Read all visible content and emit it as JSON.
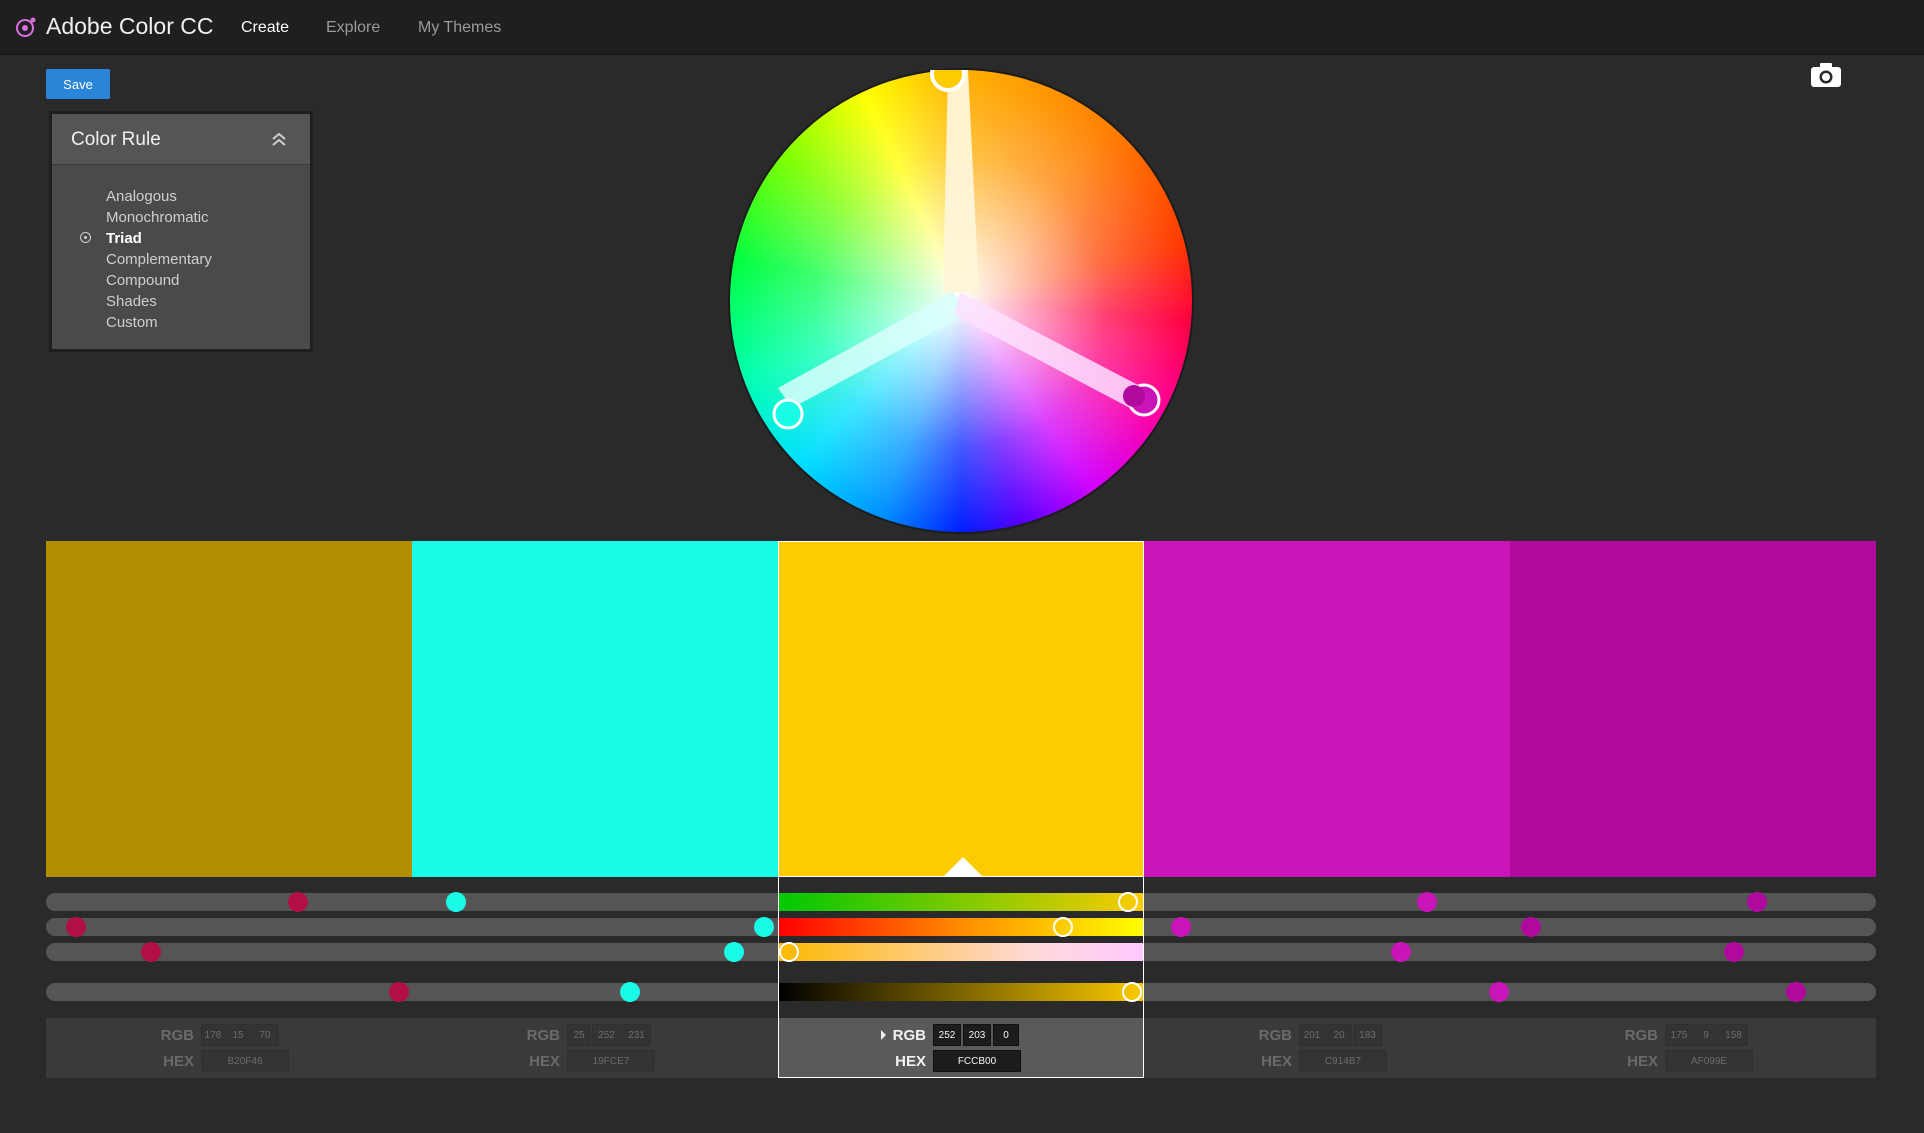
{
  "app": {
    "title": "Adobe Color CC",
    "nav": [
      "Create",
      "Explore",
      "My Themes"
    ],
    "active_nav": "Create"
  },
  "toolbar": {
    "save_label": "Save",
    "camera_icon": "camera-icon"
  },
  "color_rule": {
    "title": "Color Rule",
    "collapse_icon": "double-chevron-up-icon",
    "options": [
      "Analogous",
      "Monochromatic",
      "Triad",
      "Complementary",
      "Compound",
      "Shades",
      "Custom"
    ],
    "selected": "Triad"
  },
  "theme": {
    "selected_index": 2,
    "swatches": [
      {
        "hex": "#B28F00",
        "rgb": [
          "178",
          "15",
          "70"
        ],
        "hex_label": "B20F46"
      },
      {
        "hex": "#19FCE7",
        "rgb": [
          "25",
          "252",
          "231"
        ],
        "hex_label": "19FCE7"
      },
      {
        "hex": "#FCCB00",
        "rgb": [
          "252",
          "203",
          "0"
        ],
        "hex_label": "FCCB00"
      },
      {
        "hex": "#C914B7",
        "rgb": [
          "201",
          "20",
          "183"
        ],
        "hex_label": "C914B7"
      },
      {
        "hex": "#AF099E",
        "rgb": [
          "175",
          "9",
          "158"
        ],
        "hex_label": "AF099E"
      }
    ]
  },
  "labels": {
    "rgb": "RGB",
    "hex": "HEX"
  },
  "colors": {
    "accent": "#2a85d9",
    "crimson_knob": "#b20f46",
    "cyan_knob": "#19fce7",
    "magenta_knob": "#c914b7"
  }
}
